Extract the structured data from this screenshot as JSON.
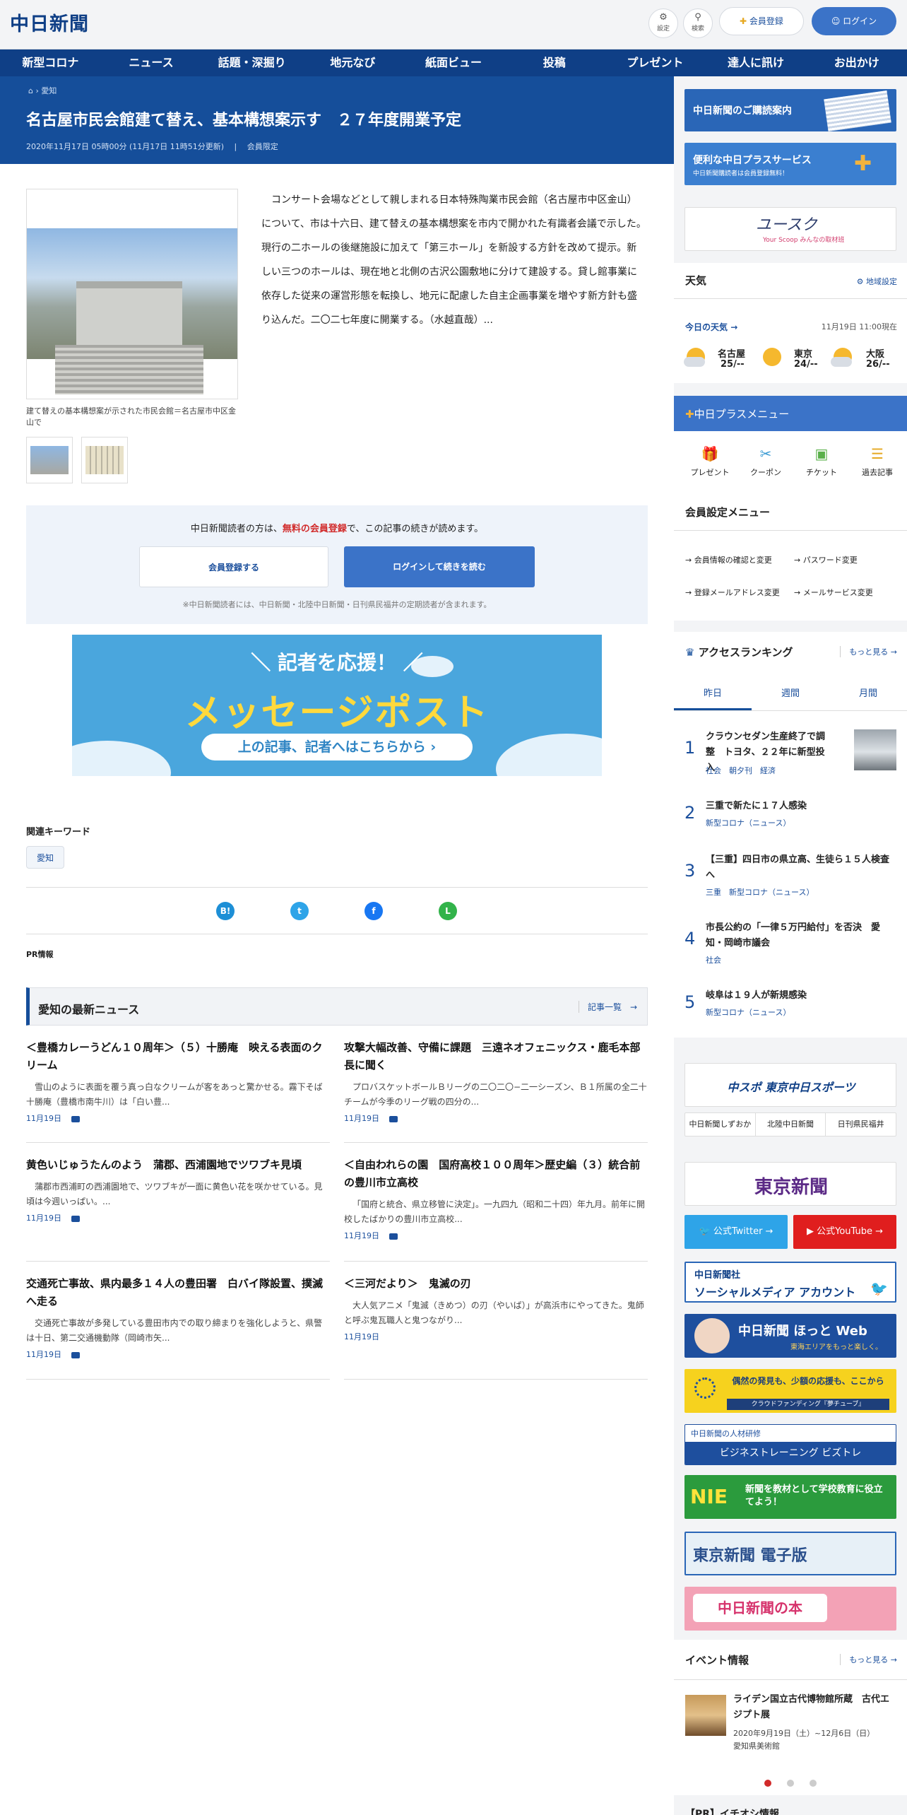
{
  "header": {
    "logo": "中日新聞",
    "settings_label": "設定",
    "search_label": "検索",
    "register_label": "会員登録",
    "login_label": "ログイン"
  },
  "nav": [
    "新型コロナ",
    "ニュース",
    "話題・深掘り",
    "地元なび",
    "紙面ビュー",
    "投稿",
    "プレゼント",
    "達人に訊け",
    "お出かけ"
  ],
  "breadcrumb": {
    "current": "愛知"
  },
  "article": {
    "title": "名古屋市民会館建て替え、基本構想案示す　２７年度開業予定",
    "date": "2020年11月17日 05時00分 (11月17日 11時51分更新)",
    "members_only": "会員限定",
    "photo_caption": "建て替えの基本構想案が示された市民会館＝名古屋市中区金山で",
    "body": "コンサート会場などとして親しまれる日本特殊陶業市民会館（名古屋市中区金山）について、市は十六日、建て替えの基本構想案を市内で開かれた有識者会議で示した。現行の二ホールの後継施設に加えて「第三ホール」を新設する方針を改めて提示。新しい三つのホールは、現在地と北側の古沢公園敷地に分けて建設する。貸し館事業に依存した従来の運営形態を転換し、地元に配慮した自主企画事業を増やす新方針も盛り込んだ。二〇二七年度に開業する。（水越直哉）..."
  },
  "paywall": {
    "lead_pre": "中日新聞読者の方は、",
    "lead_link": "無料の会員登録",
    "lead_post": "で、この記事の続きが読めます。",
    "register_button": "会員登録する",
    "login_button": "ログインして続きを読む",
    "note": "※中日新聞読者には、中日新聞・北陸中日新聞・日刊県民福井の定期読者が含まれます。"
  },
  "message_post": {
    "line1": "＼ 記者を応援！ ／",
    "line2": "メッセージポスト",
    "pill": "上の記事、記者へはこちらから ›"
  },
  "keywords": {
    "label": "関連キーワード",
    "tags": [
      "愛知"
    ]
  },
  "share": {
    "hatena": "B!",
    "twitter": "t",
    "facebook": "f",
    "line": "L"
  },
  "pr_label": "PR情報",
  "latest": {
    "heading": "愛知の最新ニュース",
    "more": "記事一覧　→"
  },
  "news": [
    {
      "title": "＜豊橋カレーうどん１０周年＞（５）十勝庵　映える表面のクリーム",
      "desc": "雪山のように表面を覆う真っ白なクリームが客をあっと驚かせる。霧下そば十勝庵（豊橋市南牛川）は「白い豊...",
      "date": "11月19日"
    },
    {
      "title": "攻撃大幅改善、守備に課題　三遠ネオフェニックス・鹿毛本部長に聞く",
      "desc": "プロバスケットボールＢリーグの二〇二〇−二一シーズン、Ｂ１所属の全二十チームが今季のリーグ戦の四分の...",
      "date": "11月19日"
    },
    {
      "title": "黄色いじゅうたんのよう　蒲郡、西浦園地でツワブキ見頃",
      "desc": "蒲郡市西浦町の西浦園地で、ツワブキが一面に黄色い花を咲かせている。見頃は今週いっぱい。...",
      "date": "11月19日"
    },
    {
      "title": "＜自由われらの園　国府高校１００周年＞歴史編（３）統合前の豊川市立高校",
      "desc": "「国府と統合、県立移管に決定」。一九四九（昭和二十四）年九月。前年に開校したばかりの豊川市立高校...",
      "date": "11月19日"
    },
    {
      "title": "交通死亡事故、県内最多１４人の豊田署　白バイ隊設置、撲滅へ走る",
      "desc": "交通死亡事故が多発している豊田市内での取り締まりを強化しようと、県警は十日、第二交通機動隊（岡崎市矢...",
      "date": "11月19日"
    },
    {
      "title": "＜三河だより＞　鬼滅の刃",
      "desc": "大人気アニメ「鬼滅（きめつ）の刃（やいば）」が高浜市にやってきた。鬼師と呼ぶ鬼瓦職人と鬼つながり...",
      "date": "11月19日"
    }
  ],
  "sidebar": {
    "banner1": "中日新聞のご購読案内",
    "banner2_title": "便利な中日プラスサービス",
    "banner2_sub": "中日新聞購読者は会員登録無料！",
    "banner3": "ユースク",
    "banner3_sub": "Your Scoop みんなの取材班",
    "weather": {
      "heading": "天気",
      "setting": "地域設定",
      "today": "今日の天気",
      "time": "11月19日 11:00現在",
      "cities": [
        {
          "name": "名古屋",
          "temp": "25/--"
        },
        {
          "name": "東京",
          "temp": "24/--"
        },
        {
          "name": "大阪",
          "temp": "26/--"
        }
      ]
    },
    "plus_menu": {
      "heading": "中日プラスメニュー",
      "items": [
        "プレゼント",
        "クーポン",
        "チケット",
        "過去記事"
      ]
    },
    "member_menu": {
      "heading": "会員設定メニュー",
      "items": [
        "会員情報の確認と変更",
        "パスワード変更",
        "登録メールアドレス変更",
        "メールサービス変更"
      ]
    },
    "ranking": {
      "heading": "アクセスランキング",
      "more": "もっと見る",
      "tabs": [
        "昨日",
        "週間",
        "月間"
      ],
      "items": [
        {
          "num": "1",
          "title": "クラウンセダン生産終了で調整　トヨタ、２２年に新型投入",
          "cats": "社会　朝夕刊　経済"
        },
        {
          "num": "2",
          "title": "三重で新たに１７人感染",
          "cats": "新型コロナ（ニュース）"
        },
        {
          "num": "3",
          "title": "【三重】四日市の県立高、生徒ら１５人検査へ",
          "cats": "三重　新型コロナ（ニュース）"
        },
        {
          "num": "4",
          "title": "市長公約の「一律５万円給付」を否決　愛知・岡崎市議会",
          "cats": "社会"
        },
        {
          "num": "5",
          "title": "岐阜は１９人が新規感染",
          "cats": "新型コロナ（ニュース）"
        }
      ]
    },
    "chuspo": "中スポ 東京中日スポーツ",
    "links3": [
      "中日新聞しずおか",
      "北陸中日新聞",
      "日刊県民福井"
    ],
    "tokyo": "東京新聞",
    "twitter": "公式Twitter →",
    "youtube": "公式YouTube →",
    "sns_1": "中日新聞社",
    "sns_2": "ソーシャルメディア アカウント",
    "hotto": "中日新聞 ほっと Web",
    "hotto_sub": "東海エリアをもっと楽しく。",
    "crowd": "偶然の発見も、少額の応援も、ここから",
    "crowd_sub": "クラウドファンディング『夢チューブ』",
    "bizu": "中日新聞の人材研修",
    "bizu_sub": "ビジネストレーニング ビズトレ",
    "nie": "新聞を教材として学校教育に役立てよう！",
    "tokyo_e": "東京新聞 電子版",
    "book": "中日新聞の本",
    "events": {
      "heading": "イベント情報",
      "more": "もっと見る",
      "title": "ライデン国立古代博物館所蔵　古代エジプト展",
      "date": "2020年9月19日（土）~12月6日（日）",
      "place": "愛知県美術館"
    },
    "pr_bottom": "【PR】イチオシ情報"
  }
}
